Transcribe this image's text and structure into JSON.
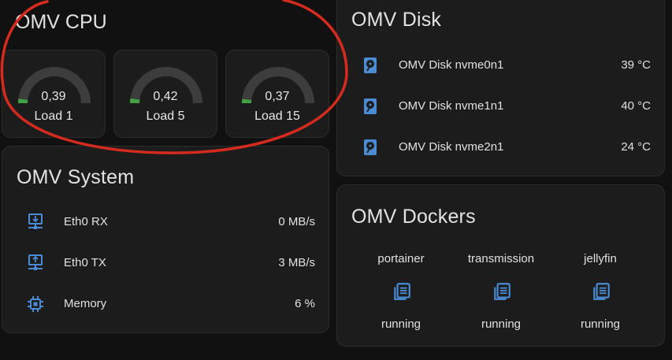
{
  "colors": {
    "background": "#111111",
    "card": "#1c1c1c",
    "icon_blue": "#4a8bd4",
    "gauge_green": "#43a047",
    "gauge_track": "#3d3d3d",
    "annotation_red": "#d52b1e"
  },
  "cpu": {
    "title": "OMV CPU",
    "gauges": [
      {
        "value": "0,39",
        "label": "Load 1",
        "fraction": 0.039
      },
      {
        "value": "0,42",
        "label": "Load 5",
        "fraction": 0.042
      },
      {
        "value": "0,37",
        "label": "Load 15",
        "fraction": 0.037
      }
    ]
  },
  "system": {
    "title": "OMV System",
    "rows": [
      {
        "icon": "network-download-icon",
        "name": "Eth0 RX",
        "value": "0 MB/s"
      },
      {
        "icon": "network-upload-icon",
        "name": "Eth0 TX",
        "value": "3 MB/s"
      },
      {
        "icon": "memory-chip-icon",
        "name": "Memory",
        "value": "6 %"
      }
    ]
  },
  "disk": {
    "title": "OMV Disk",
    "rows": [
      {
        "icon": "harddisk-icon",
        "name": "OMV Disk nvme0n1",
        "value": "39 °C"
      },
      {
        "icon": "harddisk-icon",
        "name": "OMV Disk nvme1n1",
        "value": "40 °C"
      },
      {
        "icon": "harddisk-icon",
        "name": "OMV Disk nvme2n1",
        "value": "24 °C"
      }
    ]
  },
  "dockers": {
    "title": "OMV Dockers",
    "items": [
      {
        "name": "portainer",
        "icon": "container-list-icon",
        "state": "running"
      },
      {
        "name": "transmission",
        "icon": "container-list-icon",
        "state": "running"
      },
      {
        "name": "jellyfin",
        "icon": "container-list-icon",
        "state": "running"
      }
    ]
  }
}
